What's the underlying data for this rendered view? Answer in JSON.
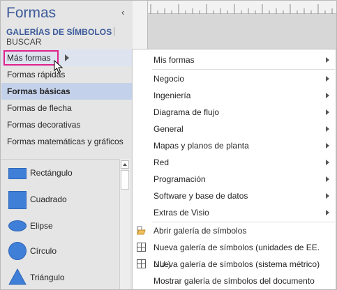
{
  "pane": {
    "title": "Formas",
    "collapse_glyph": "‹",
    "tab_active": "GALERÍAS DE SÍMBOLOS",
    "tab_inactive": "BUSCAR"
  },
  "menu": {
    "more_shapes": "Más formas",
    "items": [
      "Formas rápidas",
      "Formas básicas",
      "Formas de flecha",
      "Formas decorativas",
      "Formas matemáticas y gráficos"
    ],
    "selected_index": 1
  },
  "stencil": {
    "shapes": [
      {
        "label": "Rectángulo",
        "icon": "rectangle-icon"
      },
      {
        "label": "Cuadrado",
        "icon": "square-icon"
      },
      {
        "label": "Elipse",
        "icon": "ellipse-icon"
      },
      {
        "label": "Círculo",
        "icon": "circle-icon"
      },
      {
        "label": "Triángulo",
        "icon": "triangle-icon"
      }
    ],
    "shape_color": "#3f7fd8"
  },
  "flyout": {
    "submenus": [
      "Mis formas",
      "Negocio",
      "Ingeniería",
      "Diagrama de flujo",
      "General",
      "Mapas y planos de planta",
      "Red",
      "Programación",
      "Software y base de datos",
      "Extras de Visio"
    ],
    "actions": [
      {
        "label": "Abrir galería de símbolos",
        "icon": "open-folder-icon"
      },
      {
        "label": "Nueva galería de símbolos (unidades de EE. UU.)",
        "icon": "grid-icon"
      },
      {
        "label": "Nueva galería de símbolos (sistema métrico)",
        "icon": "grid-icon"
      },
      {
        "label": "Mostrar galería de símbolos del documento",
        "icon": ""
      }
    ]
  },
  "colors": {
    "accent": "#3c5a9a",
    "highlight_box": "#e0218a",
    "selected_row": "#c4d1ea"
  }
}
